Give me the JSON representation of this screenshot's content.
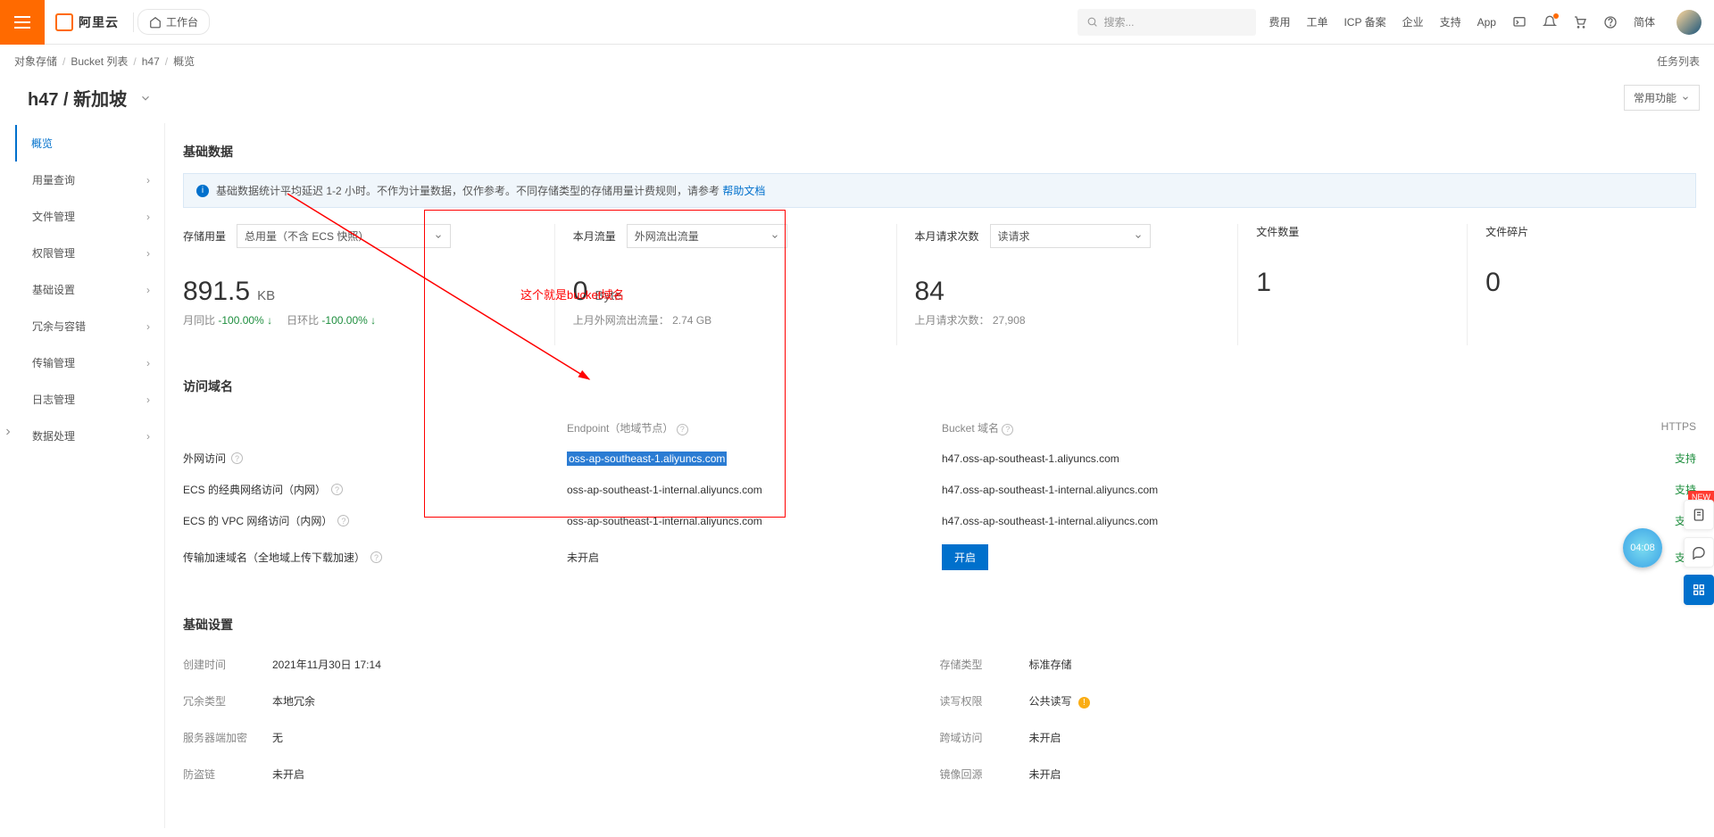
{
  "top": {
    "logo_text": "阿里云",
    "home_label": "工作台",
    "search_placeholder": "搜索...",
    "links": {
      "fee": "费用",
      "ticket": "工单",
      "icp": "ICP 备案",
      "enterprise": "企业",
      "support": "支持",
      "app": "App",
      "lang": "简体"
    }
  },
  "breadcrumb": {
    "a": "对象存储",
    "b": "Bucket 列表",
    "c": "h47",
    "d": "概览"
  },
  "task_list": "任务列表",
  "title": "h47 / 新加坡",
  "common_func_btn": "常用功能",
  "sidebar": {
    "items": [
      "概览",
      "用量查询",
      "文件管理",
      "权限管理",
      "基础设置",
      "冗余与容错",
      "传输管理",
      "日志管理",
      "数据处理"
    ]
  },
  "section_basic": "基础数据",
  "info_note_pre": "基础数据统计平均延迟 1-2 小时。不作为计量数据，仅作参考。不同存储类型的存储用量计费规则，请参考 ",
  "info_note_link": "帮助文档",
  "stats": {
    "storage": {
      "label": "存储用量",
      "select": "总用量（不含 ECS 快照）",
      "value": "891.5",
      "unit": "KB",
      "sub_a_label": "月同比",
      "sub_a_val": "-100.00% ↓",
      "sub_b_label": "日环比",
      "sub_b_val": "-100.00% ↓"
    },
    "traffic": {
      "label": "本月流量",
      "select": "外网流出流量",
      "value": "0",
      "unit": "Byte",
      "sub_label": "上月外网流出流量：",
      "sub_val": "2.74 GB"
    },
    "requests": {
      "label": "本月请求次数",
      "select": "读请求",
      "value": "84",
      "sub_label": "上月请求次数：",
      "sub_val": "27,908"
    },
    "files": {
      "label": "文件数量",
      "value": "1"
    },
    "frags": {
      "label": "文件碎片",
      "value": "0"
    }
  },
  "section_domain": "访问域名",
  "domain_header": {
    "endpoint": "Endpoint（地域节点）",
    "bucket": "Bucket 域名",
    "https": "HTTPS"
  },
  "domain_rows": [
    {
      "label": "外网访问",
      "endpoint": "oss-ap-southeast-1.aliyuncs.com",
      "bucket": "h47.oss-ap-southeast-1.aliyuncs.com",
      "https": "支持",
      "hl": true
    },
    {
      "label": "ECS 的经典网络访问（内网）",
      "endpoint": "oss-ap-southeast-1-internal.aliyuncs.com",
      "bucket": "h47.oss-ap-southeast-1-internal.aliyuncs.com",
      "https": "支持"
    },
    {
      "label": "ECS 的 VPC 网络访问（内网）",
      "endpoint": "oss-ap-southeast-1-internal.aliyuncs.com",
      "bucket": "h47.oss-ap-southeast-1-internal.aliyuncs.com",
      "https": "支持"
    },
    {
      "label": "传输加速域名（全地域上传下载加速）",
      "endpoint": "未开启",
      "bucket_btn": "开启",
      "https": "支持"
    }
  ],
  "section_settings": "基础设置",
  "settings": {
    "created_label": "创建时间",
    "created_val": "2021年11月30日 17:14",
    "storage_type_label": "存储类型",
    "storage_type_val": "标准存储",
    "redundancy_label": "冗余类型",
    "redundancy_val": "本地冗余",
    "rw_label": "读写权限",
    "rw_val": "公共读写",
    "encrypt_label": "服务器端加密",
    "encrypt_val": "无",
    "cors_label": "跨域访问",
    "cors_val": "未开启",
    "referer_label": "防盗链",
    "referer_val": "未开启",
    "mirror_label": "镜像回源",
    "mirror_val": "未开启"
  },
  "annotation": "这个就是bucket域名",
  "timer": "04:08",
  "new_tag": "NEW"
}
